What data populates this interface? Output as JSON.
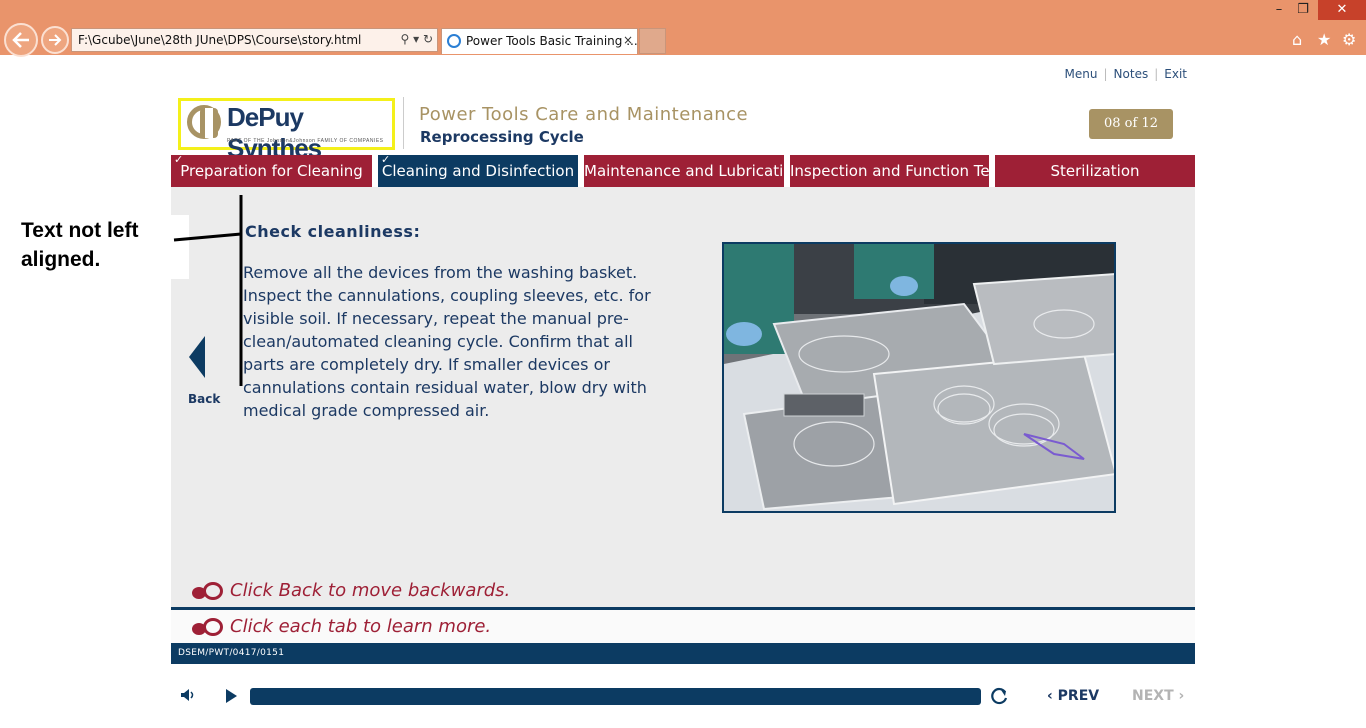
{
  "browser": {
    "address": "F:\\Gcube\\June\\28th JUne\\DPS\\Course\\story.html",
    "tab_title": "Power Tools Basic Training ...",
    "tab_close": "×",
    "window_min": "–",
    "window_max": "❐",
    "window_close": "✕",
    "address_icons": "⚲ ▾ ↻"
  },
  "top_links": {
    "menu": "Menu",
    "notes": "Notes",
    "exit": "Exit"
  },
  "brand": {
    "name": "DePuy Synthes",
    "sub": "PART OF THE Johnson&Johnson FAMILY OF COMPANIES"
  },
  "course": {
    "title": "Power Tools Care and Maintenance",
    "subtitle": "Reprocessing Cycle",
    "counter": "08 of 12"
  },
  "tabs": [
    {
      "label": "Preparation for Cleaning",
      "checked": true
    },
    {
      "label": "Cleaning and Disinfection",
      "checked": true
    },
    {
      "label": "Maintenance and Lubrication",
      "checked": false
    },
    {
      "label": "Inspection and Function Test",
      "checked": false
    },
    {
      "label": "Sterilization",
      "checked": false
    }
  ],
  "content": {
    "title": "Check cleanliness:",
    "body": "Remove all the devices from the washing basket. Inspect the cannulations, coupling sleeves, etc. for visible soil. If necessary, repeat the manual pre-clean/automated cleaning cycle. Confirm that all parts are completely dry. If smaller devices or cannulations contain residual water, blow dry with medical grade compressed air."
  },
  "back_label": "Back",
  "hints": {
    "back": "Click Back to move backwards.",
    "tabs": "Click each tab to learn more."
  },
  "footer_code": "DSEM/PWT/0417/0151",
  "player": {
    "prev": "PREV",
    "next": "NEXT"
  },
  "annotation": "Text not left aligned.",
  "colors": {
    "tab_red": "#9e2036",
    "navy": "#0c3b62",
    "gold": "#a89364"
  }
}
